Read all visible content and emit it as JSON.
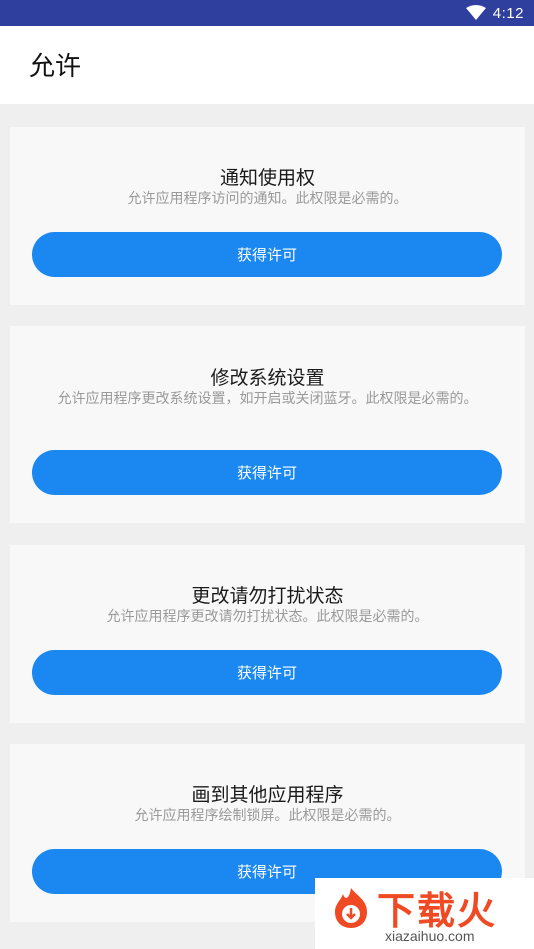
{
  "status_bar": {
    "time": "4:12",
    "wifi_icon": "wifi-icon",
    "background": "#2f3f9e"
  },
  "app_bar": {
    "title": "允许"
  },
  "permissions": [
    {
      "title": "通知使用权",
      "description": "允许应用程序访问的通知。此权限是必需的。",
      "button_label": "获得许可"
    },
    {
      "title": "修改系统设置",
      "description": "允许应用程序更改系统设置，如开启或关闭蓝牙。此权限是必需的。",
      "button_label": "获得许可"
    },
    {
      "title": "更改请勿打扰状态",
      "description": "允许应用程序更改请勿打扰状态。此权限是必需的。",
      "button_label": "获得许可"
    },
    {
      "title": "画到其他应用程序",
      "description": "允许应用程序绘制锁屏。此权限是必需的。",
      "button_label": "获得许可"
    }
  ],
  "watermark": {
    "logo_text": "下载火",
    "site": "xiazaihuo.com"
  },
  "colors": {
    "accent": "#1a88f0",
    "status_bar": "#2f3f9e",
    "card_bg": "#f8f8f8",
    "page_bg": "#efefef",
    "desc_text": "#999999",
    "watermark": "#ef4a23"
  }
}
